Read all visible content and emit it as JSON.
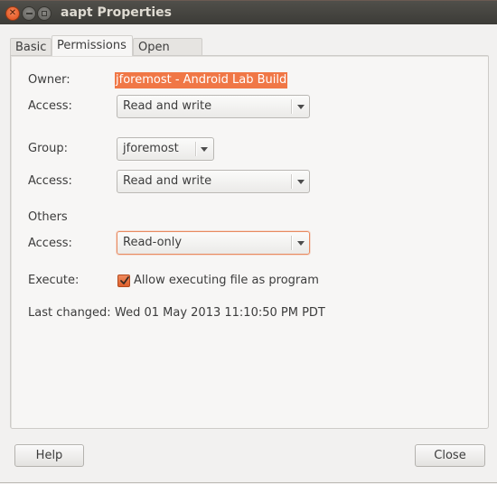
{
  "window": {
    "title": "aapt Properties",
    "controls": {
      "close_icon": "close-icon",
      "minimize_icon": "minimize-icon",
      "maximize_icon": "maximize-icon"
    }
  },
  "tabs": [
    {
      "label": "Basic",
      "active": false
    },
    {
      "label": "Permissions",
      "active": true
    },
    {
      "label": "Open With",
      "active": false
    }
  ],
  "permissions": {
    "owner": {
      "label": "Owner:",
      "value": "jforemost - Android Lab Build",
      "selected": true
    },
    "owner_access": {
      "label": "Access:",
      "value": "Read and write"
    },
    "group": {
      "label": "Group:",
      "value": "jforemost"
    },
    "group_access": {
      "label": "Access:",
      "value": "Read and write"
    },
    "others": {
      "heading": "Others",
      "access_label": "Access:",
      "access_value": "Read-only",
      "focused": true
    },
    "execute": {
      "label": "Execute:",
      "checkbox_label": "Allow executing file as program",
      "checked": true
    },
    "last_changed": {
      "label": "Last changed:",
      "value": "Wed 01 May 2013 11:10:50 PM PDT"
    }
  },
  "buttons": {
    "help": "Help",
    "close": "Close"
  },
  "colors": {
    "accent": "#f07746",
    "titlebar": "#3c3b37",
    "background": "#f2f1f0"
  }
}
